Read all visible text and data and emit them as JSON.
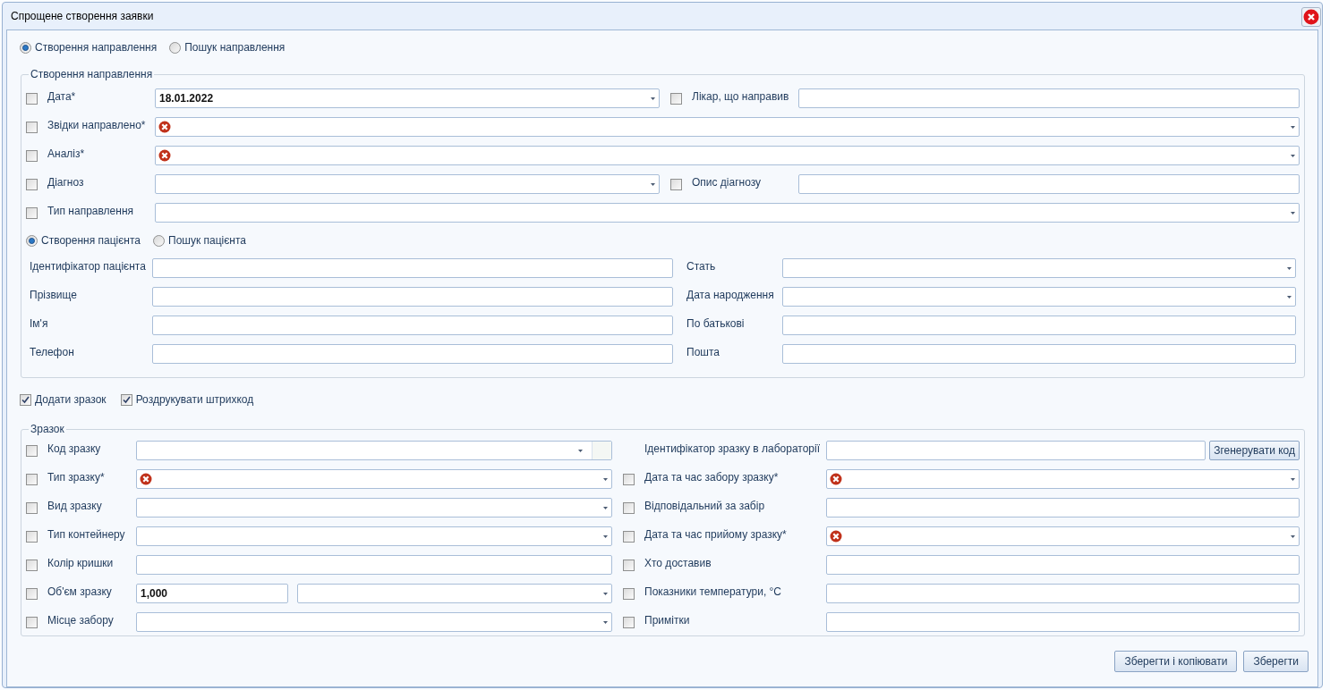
{
  "window": {
    "title": "Спрощене створення заявки"
  },
  "mode": [
    {
      "label": "Створення направлення",
      "selected": true
    },
    {
      "label": "Пошук направлення",
      "selected": false
    }
  ],
  "referral": {
    "title": "Створення направлення",
    "rows": [
      {
        "fields": [
          {
            "label": "Дата*",
            "checked": false,
            "inputs": [
              {
                "kind": "dropdown",
                "value": "18.01.2022",
                "invalid": false
              }
            ]
          },
          {
            "label": "Лікар, що направив",
            "checked": false,
            "inputs": [
              {
                "kind": "text",
                "invalid": false
              }
            ]
          }
        ]
      },
      {
        "fields": [
          {
            "label": "Звідки направлено*",
            "checked": false,
            "inputs": [
              {
                "kind": "dropdown",
                "invalid": true
              }
            ]
          }
        ]
      },
      {
        "fields": [
          {
            "label": "Аналіз*",
            "checked": false,
            "inputs": [
              {
                "kind": "dropdown",
                "invalid": true
              }
            ]
          }
        ]
      },
      {
        "fields": [
          {
            "label": "Діагноз",
            "checked": false,
            "inputs": [
              {
                "kind": "dropdown",
                "invalid": false
              }
            ]
          },
          {
            "label": "Опис діагнозу",
            "checked": false,
            "inputs": [
              {
                "kind": "text",
                "invalid": false
              }
            ]
          }
        ]
      },
      {
        "fields": [
          {
            "label": "Тип направлення",
            "checked": false,
            "inputs": [
              {
                "kind": "dropdown",
                "invalid": false
              }
            ]
          }
        ]
      }
    ],
    "patient_mode": [
      {
        "label": "Створення пацієнта",
        "selected": true
      },
      {
        "label": "Пошук пацієнта",
        "selected": false
      }
    ],
    "patient_rows": [
      {
        "fields": [
          {
            "label": "Ідентифікатор пацієнта",
            "inputs": [
              {
                "kind": "text",
                "invalid": false
              }
            ]
          },
          {
            "label": "Стать",
            "inputs": [
              {
                "kind": "dropdown",
                "invalid": false
              }
            ]
          }
        ]
      },
      {
        "fields": [
          {
            "label": "Прізвище",
            "inputs": [
              {
                "kind": "text",
                "invalid": false
              }
            ]
          },
          {
            "label": "Дата народження",
            "inputs": [
              {
                "kind": "dropdown",
                "invalid": false
              }
            ]
          }
        ]
      },
      {
        "fields": [
          {
            "label": "Ім'я",
            "inputs": [
              {
                "kind": "text",
                "invalid": false
              }
            ]
          },
          {
            "label": "По батькові",
            "inputs": [
              {
                "kind": "text",
                "invalid": false
              }
            ]
          }
        ]
      },
      {
        "fields": [
          {
            "label": "Телефон",
            "inputs": [
              {
                "kind": "text",
                "invalid": false
              }
            ]
          },
          {
            "label": "Пошта",
            "inputs": [
              {
                "kind": "text",
                "invalid": false
              }
            ]
          }
        ]
      }
    ]
  },
  "options": [
    {
      "label": "Додати зразок",
      "checked": true
    },
    {
      "label": "Роздрукувати штрихкод",
      "checked": true
    }
  ],
  "sample": {
    "title": "Зразок",
    "rows": [
      {
        "fields": [
          {
            "label": "Код зразку",
            "checked": false,
            "inputs": [
              {
                "kind": "dropdown_add",
                "invalid": false
              }
            ]
          },
          {
            "label": "Ідентифікатор зразку в лабораторії",
            "inputs": [
              {
                "kind": "text",
                "invalid": false
              }
            ],
            "button": "Згенерувати код"
          }
        ]
      },
      {
        "fields": [
          {
            "label": "Тип зразку*",
            "checked": false,
            "inputs": [
              {
                "kind": "dropdown",
                "invalid": true
              }
            ]
          },
          {
            "label": "Дата та час забору зразку*",
            "checked": false,
            "inputs": [
              {
                "kind": "dropdown",
                "invalid": true
              }
            ]
          }
        ]
      },
      {
        "fields": [
          {
            "label": "Вид зразку",
            "checked": false,
            "inputs": [
              {
                "kind": "dropdown",
                "invalid": false
              }
            ]
          },
          {
            "label": "Відповідальний за забір",
            "checked": false,
            "inputs": [
              {
                "kind": "text",
                "invalid": false
              }
            ]
          }
        ]
      },
      {
        "fields": [
          {
            "label": "Тип контейнеру",
            "checked": false,
            "inputs": [
              {
                "kind": "dropdown",
                "invalid": false
              }
            ]
          },
          {
            "label": "Дата та час прийому зразку*",
            "checked": false,
            "inputs": [
              {
                "kind": "dropdown",
                "invalid": true
              }
            ]
          }
        ]
      },
      {
        "fields": [
          {
            "label": "Колір кришки",
            "checked": false,
            "inputs": [
              {
                "kind": "text",
                "invalid": false
              }
            ]
          },
          {
            "label": "Хто доставив",
            "checked": false,
            "inputs": [
              {
                "kind": "text",
                "invalid": false
              }
            ]
          }
        ]
      },
      {
        "fields": [
          {
            "label": "Об'єм зразку",
            "checked": false,
            "inputs": [
              {
                "kind": "text",
                "value": "1,000",
                "invalid": false
              },
              {
                "kind": "dropdown",
                "invalid": false
              }
            ]
          },
          {
            "label": "Показники температури, °C",
            "checked": false,
            "inputs": [
              {
                "kind": "text",
                "invalid": false
              }
            ]
          }
        ]
      },
      {
        "fields": [
          {
            "label": "Місце забору",
            "checked": false,
            "inputs": [
              {
                "kind": "dropdown",
                "invalid": false
              }
            ]
          },
          {
            "label": "Примітки",
            "checked": false,
            "inputs": [
              {
                "kind": "text",
                "invalid": false
              }
            ]
          }
        ]
      }
    ]
  },
  "buttons": [
    "Зберегти і копіювати",
    "Зберегти"
  ]
}
